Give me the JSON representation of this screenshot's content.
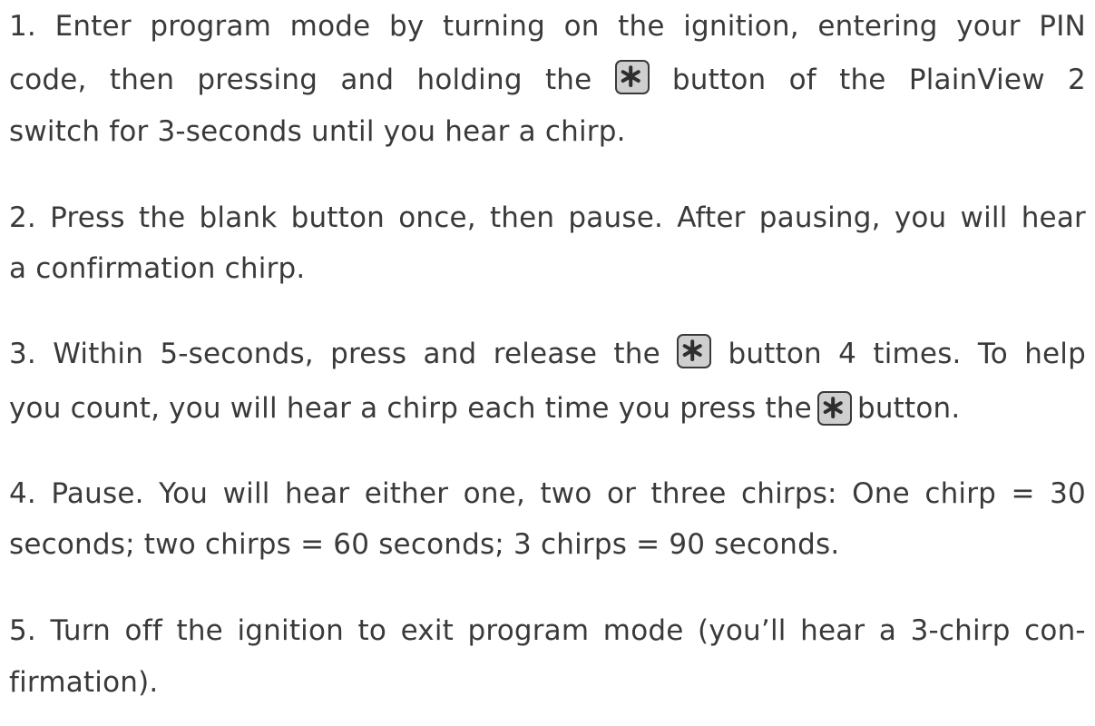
{
  "icon": "asterisk-key-icon",
  "steps": [
    {
      "lines": [
        [
          "1.",
          "Enter",
          "program",
          "mode",
          "by",
          "turning",
          "on",
          "the",
          "ignition,",
          "entering",
          "your",
          "PIN"
        ],
        [
          "code,",
          "then",
          "pressing",
          "and",
          "holding",
          "the",
          "button",
          "of",
          "the",
          "PlainView",
          "2"
        ],
        "switch for 3-seconds until you hear a chirp."
      ]
    },
    {
      "lines": [
        [
          "2.",
          "Press",
          "the",
          "blank",
          "button",
          "once,",
          "then",
          "pause.",
          "After",
          "pausing,",
          "you",
          "will",
          "hear"
        ],
        "a confirmation chirp."
      ]
    },
    {
      "lines": [
        [
          "3.",
          "Within",
          "5-seconds,",
          "press",
          "and",
          "release",
          "the",
          "button",
          "4",
          "times.",
          "To",
          "help"
        ],
        [
          "you count, you will hear a chirp each time you press the",
          "button."
        ]
      ]
    },
    {
      "lines": [
        [
          "4.",
          "Pause.",
          "You",
          "will",
          "hear",
          "either",
          "one,",
          "two",
          "or",
          "three",
          "chirps:",
          "One",
          "chirp",
          "=",
          "30"
        ],
        "seconds; two chirps = 60 seconds; 3 chirps = 90 seconds."
      ]
    },
    {
      "lines": [
        [
          "5.",
          "Turn",
          "off",
          "the",
          "ignition",
          "to",
          "exit",
          "program",
          "mode",
          "(you’ll",
          "hear",
          "a",
          "3-chirp",
          "con-"
        ],
        "firmation)."
      ]
    }
  ]
}
